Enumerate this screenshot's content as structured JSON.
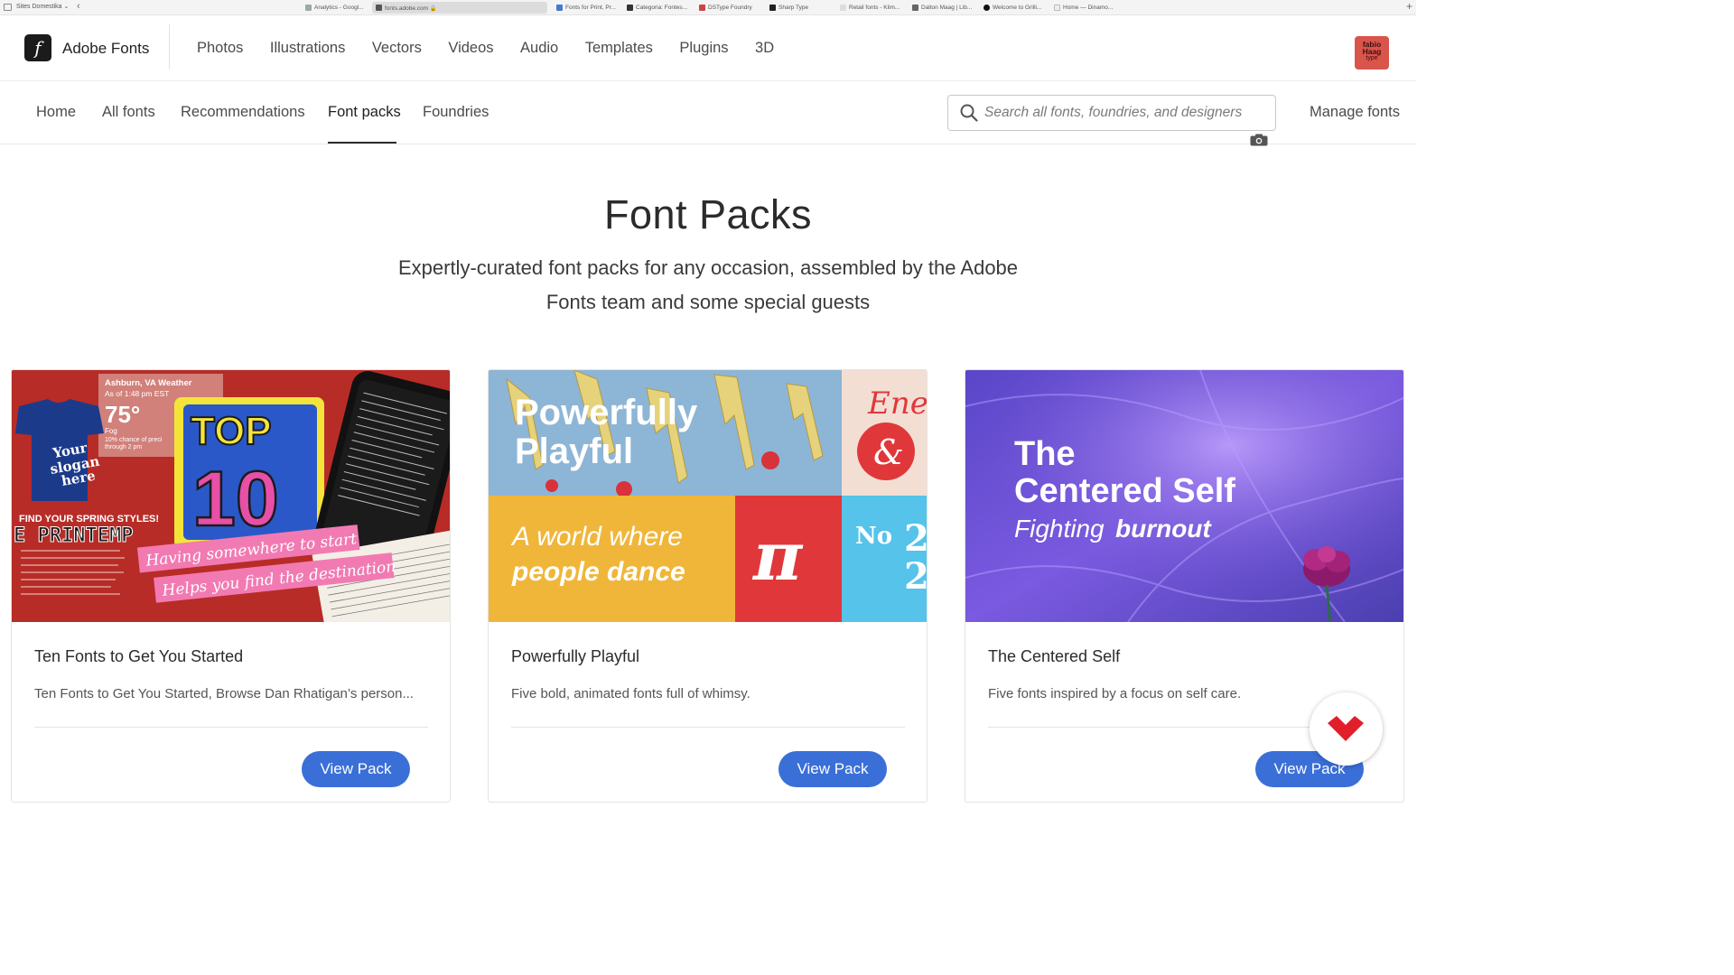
{
  "browser": {
    "group_label": "Sites Domestika ⌄",
    "tabs": [
      {
        "label": "Analytics - Googl..."
      },
      {
        "label": "fonts.adobe.com 🔒"
      },
      {
        "label": "Fonts for Print, Pr..."
      },
      {
        "label": "Categoria: Fontes..."
      },
      {
        "label": "DSType Foundry"
      },
      {
        "label": "Sharp Type"
      },
      {
        "label": "Retail fonts - Klim..."
      },
      {
        "label": "Dalton Maag | Lib..."
      },
      {
        "label": "Welcome to Grilli..."
      },
      {
        "label": "Home — Dinamo..."
      }
    ]
  },
  "header": {
    "logo_glyph": "f",
    "brand": "Adobe Fonts",
    "nav": [
      "Photos",
      "Illustrations",
      "Vectors",
      "Videos",
      "Audio",
      "Templates",
      "Plugins",
      "3D"
    ],
    "avatar": {
      "line1": "fabio",
      "line2": "Haag",
      "line3": "type",
      "color": "#d9544a"
    }
  },
  "subnav": {
    "items": [
      "Home",
      "All fonts",
      "Recommendations",
      "Font packs",
      "Foundries"
    ],
    "active": "Font packs",
    "search_placeholder": "Search all fonts, foundries, and designers",
    "manage_fonts": "Manage fonts"
  },
  "hero": {
    "title": "Font Packs",
    "subtitle_line1": "Expertly-curated font packs for any occasion, assembled by the Adobe",
    "subtitle_line2": "Fonts team and some special guests"
  },
  "cards": [
    {
      "title": "Ten Fonts to Get You Started",
      "description": "Ten Fonts to Get You Started, Browse Dan Rhatigan’s person...",
      "button": "View Pack",
      "art": {
        "weather_city": "Ashburn, VA Weather",
        "weather_time": "As of 1:48 pm EST",
        "temp": "75°",
        "weather_desc1": "Fog",
        "weather_desc2": "10% chance of preci",
        "weather_desc3": "through 2 pm",
        "shirt1": "Your",
        "shirt2": "slogan",
        "shirt3": "here",
        "top": "TOP",
        "ten": "10",
        "spring": "FIND YOUR SPRING STYLES!",
        "printemps": "E PRINTEMP",
        "banner1": "Having somewhere to start",
        "banner2": "Helps you find the destination"
      }
    },
    {
      "title": "Powerfully Playful",
      "description": "Five bold, animated fonts full of whimsy.",
      "button": "View Pack",
      "art": {
        "headline1": "Powerfully",
        "headline2": "Playful",
        "energy": "Energ",
        "ampersand": "&",
        "world1": "A world where",
        "world2": "people dance",
        "pi": "π",
        "no": "No",
        "num": "2"
      }
    },
    {
      "title": "The Centered Self",
      "description": "Five fonts inspired by a focus on self care.",
      "button": "View Pack",
      "art": {
        "line1": "The",
        "line2": "Centered Self",
        "line3a": "Fighting",
        "line3b": "burnout"
      }
    }
  ],
  "colors": {
    "accent_button": "#3a6fd8",
    "card1_bg": "#c0302a",
    "card2_sky": "#8db5d6",
    "card2_yellow": "#f0b63a",
    "card2_red": "#e0383a",
    "card2_cyan": "#55c3ea",
    "card3_purple": "#6b4fd0"
  }
}
